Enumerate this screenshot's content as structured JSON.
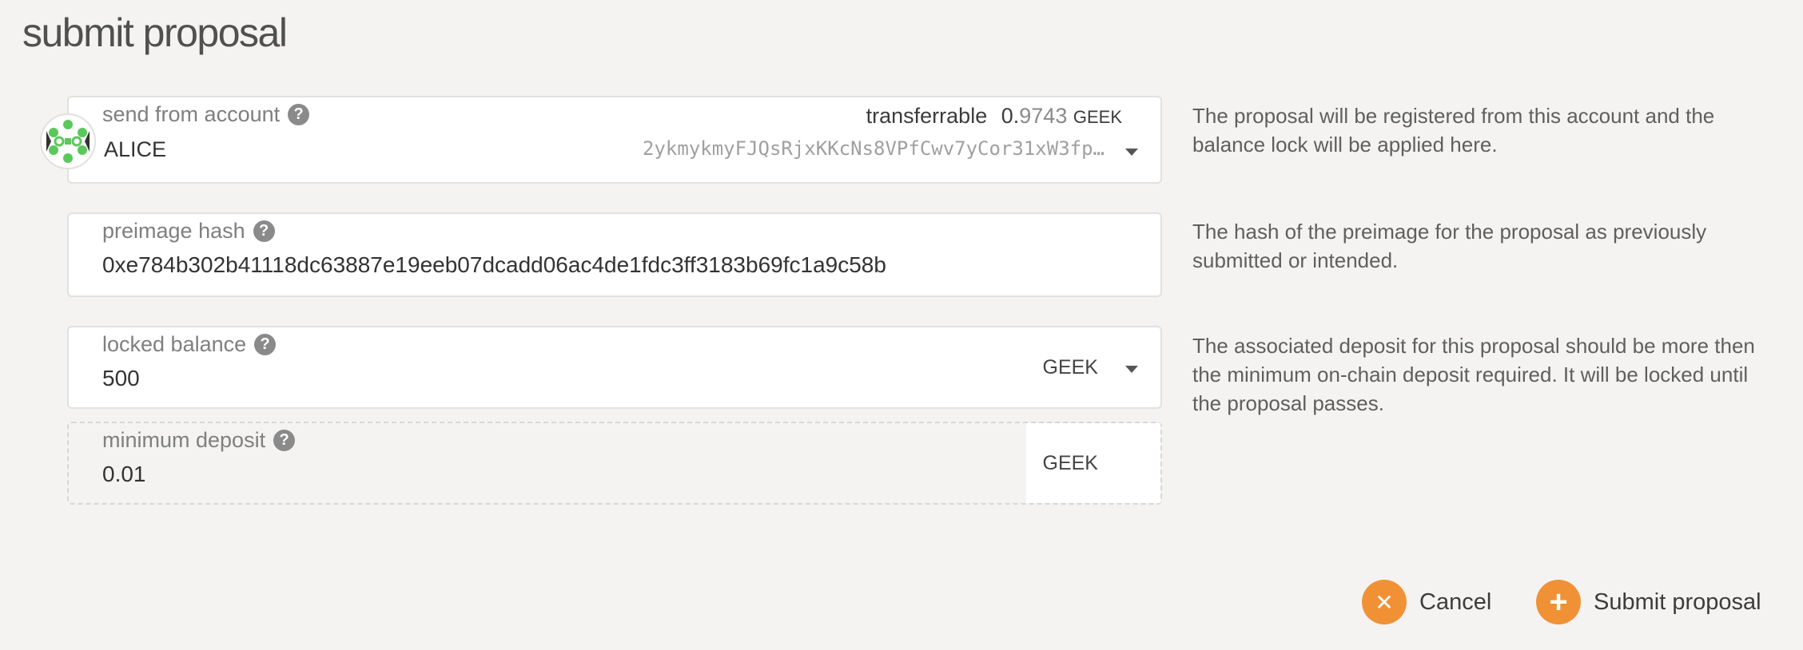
{
  "page": {
    "title": "submit proposal"
  },
  "account": {
    "label": "send from account",
    "name": "ALICE",
    "transferrable_label": "transferrable",
    "balance_int": "0.",
    "balance_frac": "9743",
    "balance_unit": "GEEK",
    "address": "2ykmykmyFJQsRjxKKcNs8VPfCwv7yCor31xW3fp…",
    "description": "The proposal will be registered from this account and the balance lock will be applied here."
  },
  "preimage": {
    "label": "preimage hash",
    "value": "0xe784b302b41118dc63887e19eeb07dcadd06ac4de1fdc3ff3183b69fc1a9c58b",
    "description": "The hash of the preimage for the proposal as previously submitted or intended."
  },
  "locked_balance": {
    "label": "locked balance",
    "value": "500",
    "unit": "GEEK",
    "description": "The associated deposit for this proposal should be more then the minimum on-chain deposit required. It will be locked until the proposal passes."
  },
  "minimum_deposit": {
    "label": "minimum deposit",
    "value": "0.01",
    "unit": "GEEK"
  },
  "actions": {
    "cancel_label": "Cancel",
    "cancel_icon": "✕",
    "submit_label": "Submit proposal",
    "submit_icon": "+"
  },
  "help_glyph": "?",
  "colors": {
    "accent": "#f19135",
    "background": "#f4f3f1"
  }
}
